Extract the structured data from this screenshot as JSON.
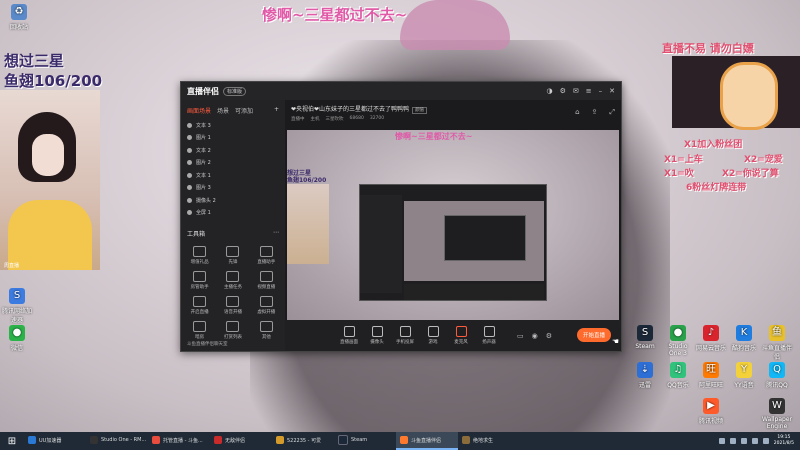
{
  "desktop": {
    "title_overlay": "惨啊~三星都过不去~",
    "left_overlay": {
      "line1": "想过三星",
      "line2": "鱼翅106/200"
    },
    "right_overlay": {
      "title": "直播不易 请勿白嫖",
      "gifts": [
        "X1加入粉丝团",
        "X1=上车",
        "X2=宠爱",
        "X1=吹",
        "X2=你说了算",
        "6粉丝灯牌连带"
      ]
    },
    "cam_label": "周直播",
    "icons_left": [
      {
        "label": "回收站",
        "icon": "recycle-bin-icon"
      },
      {
        "label": "腾讯网络加速器",
        "icon": "accelerator-icon"
      },
      {
        "label": "微信",
        "icon": "wechat-icon"
      }
    ],
    "icons_right": [
      {
        "label": "Steam",
        "icon": "steam-icon"
      },
      {
        "label": "Studio One 3",
        "icon": "studio-one-icon"
      },
      {
        "label": "网易云音乐",
        "icon": "netease-music-icon"
      },
      {
        "label": "酷狗音乐",
        "icon": "kugou-icon"
      },
      {
        "label": "斗鱼直播伴侣",
        "icon": "douyu-icon"
      },
      {
        "label": "迅雷",
        "icon": "xunlei-icon"
      },
      {
        "label": "QQ音乐",
        "icon": "qqmusic-icon"
      },
      {
        "label": "阿里旺旺",
        "icon": "aliwangwang-icon"
      },
      {
        "label": "YY语音",
        "icon": "yy-icon"
      },
      {
        "label": "腾讯QQ",
        "icon": "qq-icon"
      },
      {
        "label": "腾讯视频",
        "icon": "tencent-video-icon"
      },
      {
        "label": "Wallpaper Engine",
        "icon": "wallpaper-icon"
      }
    ]
  },
  "app": {
    "name": "直播伴侣",
    "version": "标准版",
    "window_buttons": [
      "skin",
      "settings",
      "mail",
      "menu",
      "minimize",
      "close"
    ],
    "side_tabs": [
      "画面场景",
      "场景",
      "可添加"
    ],
    "layers": [
      "文本 3",
      "图片 1",
      "文本 2",
      "图片 2",
      "文本 1",
      "图片 3",
      "摄像头 2",
      "全屏 1"
    ],
    "tools_header": "工具箱",
    "tools": [
      "增值礼品",
      "先锋",
      "直播助手",
      "房管助手",
      "主播任务",
      "视频直播",
      "开启直播",
      "语音开播",
      "虚拟开播",
      "暗房",
      "打赏列表",
      "其他"
    ],
    "side_footer": "斗鱼直播伴侣聊天室",
    "room_title": "❤央视伯❤山东妹子的三星都过不去了鸭鸭鸭",
    "room_tag": "颜值",
    "room_stats": [
      "直播中",
      "主机",
      "三星吹吹",
      "68680",
      "32700"
    ],
    "bottom_buttons": [
      "直播画面",
      "摄像头",
      "手机投屏",
      "游戏",
      "麦克风",
      "扬声器"
    ],
    "live_button": "开始直播"
  },
  "taskbar": {
    "items": [
      {
        "label": "UU加速器",
        "color": "#2a7ad5"
      },
      {
        "label": "Studio One - RM...",
        "color": "#333"
      },
      {
        "label": "托管直播 - 斗鱼...",
        "color": "#e84d3d"
      },
      {
        "label": "无敌伴侣",
        "color": "#c92b2b"
      },
      {
        "label": "522235 - 可爱",
        "color": "#d49a2a"
      },
      {
        "label": "Steam",
        "color": "#1b2838"
      },
      {
        "label": "斗鱼直播伴侣",
        "color": "#ff7a2e"
      },
      {
        "label": "绝地求生",
        "color": "#8a6d3b"
      }
    ],
    "time": "19:15",
    "date": "2021/8/5"
  }
}
